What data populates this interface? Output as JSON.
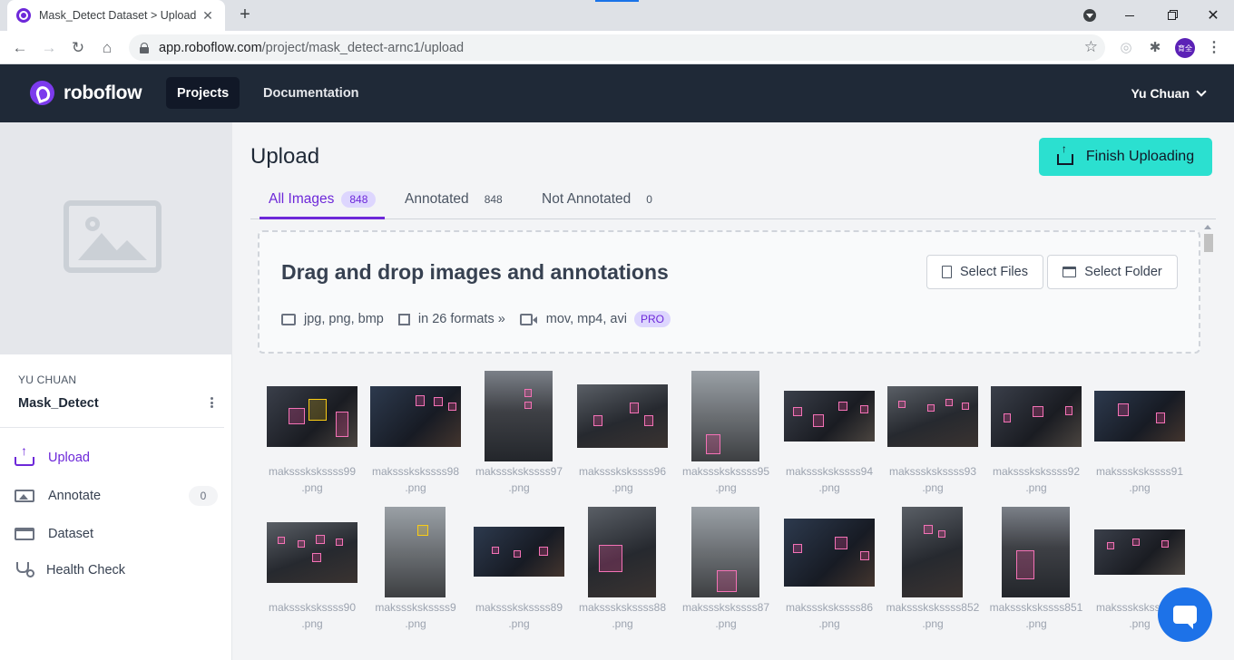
{
  "browser": {
    "tab_title": "Mask_Detect Dataset > Upload",
    "tab_close": "✕",
    "new_tab": "+",
    "url_host": "app.roboflow.com",
    "url_path": "/project/mask_detect-arnc1/upload",
    "profile_label": "育全"
  },
  "header": {
    "brand": "roboflow",
    "nav": [
      {
        "label": "Projects"
      },
      {
        "label": "Documentation"
      }
    ],
    "user": "Yu Chuan"
  },
  "sidebar": {
    "workspace": "YU CHUAN",
    "project": "Mask_Detect",
    "items": [
      {
        "label": "Upload"
      },
      {
        "label": "Annotate",
        "count": "0"
      },
      {
        "label": "Dataset"
      },
      {
        "label": "Health Check"
      }
    ]
  },
  "main": {
    "title": "Upload",
    "finish_label": "Finish Uploading",
    "tabs": [
      {
        "label": "All Images",
        "count": "848"
      },
      {
        "label": "Annotated",
        "count": "848"
      },
      {
        "label": "Not Annotated",
        "count": "0"
      }
    ],
    "dropzone": {
      "title": "Drag and drop images and annotations",
      "image_formats": "jpg, png, bmp",
      "annotation_formats": "in 26 formats",
      "video_formats": "mov, mp4, avi",
      "pro_badge": "PRO",
      "select_files": "Select Files",
      "select_folder": "Select Folder"
    },
    "images": [
      {
        "name": "makssskskssss99",
        "ext": ".png"
      },
      {
        "name": "makssskskssss98",
        "ext": ".png"
      },
      {
        "name": "makssskskssss97",
        "ext": ".png"
      },
      {
        "name": "makssskskssss96",
        "ext": ".png"
      },
      {
        "name": "makssskskssss95",
        "ext": ".png"
      },
      {
        "name": "makssskskssss94",
        "ext": ".png"
      },
      {
        "name": "makssskskssss93",
        "ext": ".png"
      },
      {
        "name": "makssskskssss92",
        "ext": ".png"
      },
      {
        "name": "makssskskssss91",
        "ext": ".png"
      },
      {
        "name": "makssskskssss90",
        "ext": ".png"
      },
      {
        "name": "makssskskssss9",
        "ext": ".png"
      },
      {
        "name": "makssskskssss89",
        "ext": ".png"
      },
      {
        "name": "makssskskssss88",
        "ext": ".png"
      },
      {
        "name": "makssskskssss87",
        "ext": ".png"
      },
      {
        "name": "makssskskssss86",
        "ext": ".png"
      },
      {
        "name": "makssskskssss852",
        "ext": ".png"
      },
      {
        "name": "makssskskssss851",
        "ext": ".png"
      },
      {
        "name": "makssskskssss85",
        "ext": ".png"
      }
    ]
  }
}
